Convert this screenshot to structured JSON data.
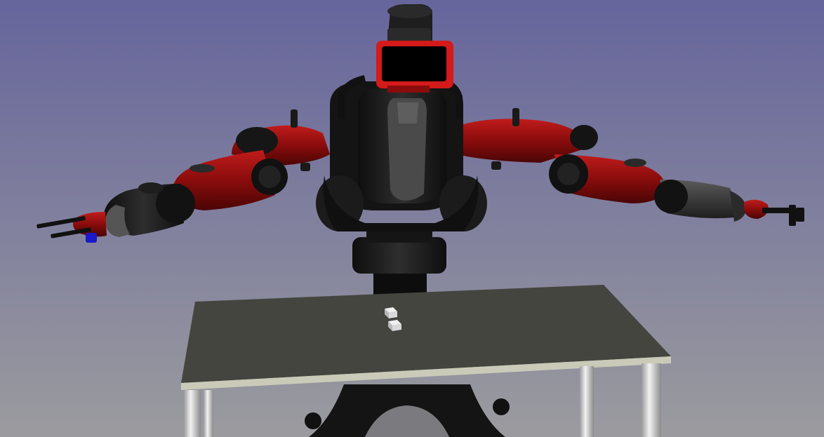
{
  "scene": {
    "colors": {
      "sky_top": "#66659c",
      "sky_bottom": "#9b9b9f",
      "robot_red": "#8a0c0c",
      "robot_red_light": "#c01c1c",
      "robot_black": "#1a1a1a",
      "robot_grey": "#3a3a3a",
      "table_top": "#44453f",
      "table_edge": "#c9cbb8",
      "table_leg": "#d8d8d8",
      "cube": "#d9d9d9",
      "screen": "#000000",
      "screen_frame": "#d41a1a",
      "accent_blue": "#1a1ac8"
    },
    "objects": [
      {
        "name": "robot",
        "label": ""
      },
      {
        "name": "table",
        "label": ""
      },
      {
        "name": "cube",
        "count": 2
      }
    ]
  }
}
